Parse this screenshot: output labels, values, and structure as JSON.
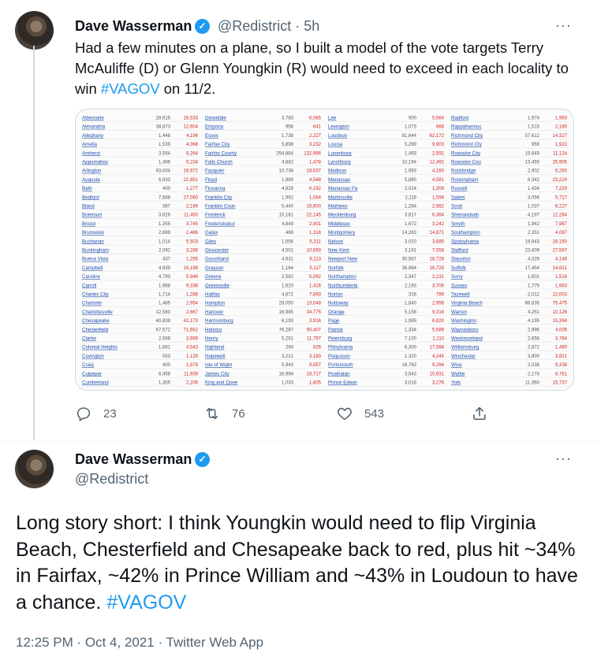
{
  "tweet1": {
    "author_name": "Dave Wasserman",
    "handle": "@Redistrict",
    "time": "5h",
    "text_pre": "Had a few minutes on a plane, so I built a model of the vote targets Terry McAuliffe (D) or Glenn Youngkin (R) would need to exceed in each locality to win ",
    "hashtag": "#VAGOV",
    "text_post": " on 11/2.",
    "replies": "23",
    "retweets": "76",
    "likes": "543",
    "media_table": {
      "columns": [
        [
          [
            "Albemarle",
            "28,615",
            "16,533"
          ],
          [
            "Alexandria",
            "38,873",
            "12,604"
          ],
          [
            "Alleghany",
            "1,448",
            "4,196"
          ],
          [
            "Amelia",
            "1,539",
            "4,068"
          ],
          [
            "Amherst",
            "3,554",
            "8,264"
          ],
          [
            "Appomattox",
            "1,496",
            "5,234"
          ],
          [
            "Arlington",
            "63,004",
            "19,972"
          ],
          [
            "Augusta",
            "6,933",
            "22,851"
          ],
          [
            "Bath",
            "400",
            "1,277"
          ],
          [
            "Bedford",
            "7,688",
            "27,060"
          ],
          [
            "Bland",
            "387",
            "2,169"
          ],
          [
            "Botetourt",
            "3,626",
            "11,450"
          ],
          [
            "Bristol",
            "1,355",
            "3,745"
          ],
          [
            "Brunswick",
            "2,689",
            "2,466"
          ],
          [
            "Buchanan",
            "1,014",
            "5,503"
          ],
          [
            "Buckingham",
            "2,092",
            "3,286"
          ],
          [
            "Buena Vista",
            "437",
            "1,255"
          ],
          [
            "Campbell",
            "4,939",
            "16,199"
          ],
          [
            "Caroline",
            "4,793",
            "5,946"
          ],
          [
            "Carroll",
            "1,968",
            "9,336"
          ],
          [
            "Charles City",
            "1,714",
            "1,286"
          ],
          [
            "Charlotte",
            "1,485",
            "2,954"
          ],
          [
            "Charlottesville",
            "12,583",
            "2,667"
          ],
          [
            "Chesapeake",
            "40,839",
            "42,173"
          ],
          [
            "Chesterfield",
            "67,572",
            "71,662"
          ],
          [
            "Clarke",
            "2,598",
            "3,989"
          ],
          [
            "Colonial Heights",
            "1,661",
            "4,543"
          ],
          [
            "Covington",
            "553",
            "1,129"
          ],
          [
            "Craig",
            "400",
            "1,878"
          ],
          [
            "Culpeper",
            "6,458",
            "11,939"
          ],
          [
            "Cumberland",
            "1,355",
            "2,206"
          ]
        ],
        [
          [
            "Dinwiddie",
            "3,783",
            "6,085"
          ],
          [
            "Emporia",
            "956",
            "641"
          ],
          [
            "Essex",
            "1,738",
            "2,227"
          ],
          [
            "Fairfax City",
            "5,898",
            "3,232"
          ],
          [
            "Fairfax County",
            "254,884",
            "132,996"
          ],
          [
            "Falls Church",
            "4,882",
            "1,478"
          ],
          [
            "Fauquier",
            "10,738",
            "18,637"
          ],
          [
            "Floyd",
            "1,989",
            "4,548"
          ],
          [
            "Fluvanna",
            "4,828",
            "6,192"
          ],
          [
            "Franklin City",
            "1,992",
            "1,084"
          ],
          [
            "Franklin Coun",
            "5,440",
            "15,600"
          ],
          [
            "Frederick",
            "10,181",
            "22,145"
          ],
          [
            "Fredericksbur",
            "4,849",
            "2,901"
          ],
          [
            "Galax",
            "469",
            "1,318"
          ],
          [
            "Giles",
            "1,556",
            "5,311"
          ],
          [
            "Gloucester",
            "4,501",
            "10,693"
          ],
          [
            "Goochland",
            "4,631",
            "8,113"
          ],
          [
            "Grayson",
            "1,164",
            "5,117"
          ],
          [
            "Greene",
            "2,582",
            "5,092"
          ],
          [
            "Greensville",
            "1,620",
            "1,416"
          ],
          [
            "Halifax",
            "4,672",
            "7,893"
          ],
          [
            "Hampton",
            "28,050",
            "13,048"
          ],
          [
            "Hanover",
            "16,985",
            "34,775"
          ],
          [
            "Harrisonburg",
            "6,193",
            "3,916"
          ],
          [
            "Henrico",
            "76,287",
            "50,407"
          ],
          [
            "Henry",
            "5,291",
            "11,797"
          ],
          [
            "Highland",
            "294",
            "826"
          ],
          [
            "Hopewell",
            "3,221",
            "3,183"
          ],
          [
            "Isle of Wight",
            "5,943",
            "9,957"
          ],
          [
            "James City",
            "16,994",
            "18,717"
          ],
          [
            "King and Quee",
            "1,033",
            "1,805"
          ]
        ],
        [
          [
            "Lee",
            "900",
            "5,564"
          ],
          [
            "Lexington",
            "1,073",
            "668"
          ],
          [
            "Loudoun",
            "81,644",
            "62,172"
          ],
          [
            "Louisa",
            "5,299",
            "9,903"
          ],
          [
            "Lunenburg",
            "1,493",
            "2,592"
          ],
          [
            "Lynchburg",
            "10,194",
            "12,492"
          ],
          [
            "Madison",
            "1,993",
            "4,160"
          ],
          [
            "Manassas",
            "5,880",
            "4,581"
          ],
          [
            "Manassas Pa",
            "2,024",
            "1,308"
          ],
          [
            "Martinsville",
            "2,118",
            "1,594"
          ],
          [
            "Mathews",
            "1,284",
            "2,982"
          ],
          [
            "Mecklenburg",
            "3,617",
            "6,364"
          ],
          [
            "Middlesex",
            "1,672",
            "3,242"
          ],
          [
            "Montgomery",
            "14,263",
            "14,871"
          ],
          [
            "Nelson",
            "3,020",
            "3,685"
          ],
          [
            "New Kent",
            "3,191",
            "7,558"
          ],
          [
            "Newport New",
            "30,567",
            "18,728"
          ],
          [
            "Norfolk",
            "36,964",
            "16,728"
          ],
          [
            "Northampton",
            "2,347",
            "2,231"
          ],
          [
            "Northumberla",
            "2,193",
            "3,706"
          ],
          [
            "Norton",
            "316",
            "789"
          ],
          [
            "Nottoway",
            "1,840",
            "2,956"
          ],
          [
            "Orange",
            "5,158",
            "9,316"
          ],
          [
            "Page",
            "1,985",
            "6,820"
          ],
          [
            "Patrick",
            "1,334",
            "5,589"
          ],
          [
            "Petersburg",
            "7,100",
            "1,110"
          ],
          [
            "Pittsylvania",
            "6,300",
            "17,568"
          ],
          [
            "Poquoson",
            "1,320",
            "4,245"
          ],
          [
            "Portsmouth",
            "18,763",
            "9,294"
          ],
          [
            "Powhatan",
            "3,643",
            "10,931"
          ],
          [
            "Prince Edwar",
            "3,018",
            "3,276"
          ]
        ],
        [
          [
            "Radford",
            "1,974",
            "1,963"
          ],
          [
            "Rappahannoc",
            "1,515",
            "2,180"
          ],
          [
            "Richmond City",
            "57,612",
            "14,327"
          ],
          [
            "Richmond Cty",
            "956",
            "1,922"
          ],
          [
            "Roanoke City",
            "15,649",
            "11,124"
          ],
          [
            "Roanoke Cou",
            "13,455",
            "25,905"
          ],
          [
            "Rockbridge",
            "2,902",
            "6,250"
          ],
          [
            "Rockingham",
            "8,342",
            "23,224"
          ],
          [
            "Russell",
            "1,434",
            "7,229"
          ],
          [
            "Salem",
            "3,056",
            "5,717"
          ],
          [
            "Scott",
            "1,037",
            "6,227"
          ],
          [
            "Shenandoah",
            "4,197",
            "12,284"
          ],
          [
            "Smyth",
            "1,942",
            "7,987"
          ],
          [
            "Southampton",
            "2,351",
            "4,087"
          ],
          [
            "Spotsylvania",
            "19,943",
            "28,150"
          ],
          [
            "Stafford",
            "23,609",
            "27,587"
          ],
          [
            "Staunton",
            "4,326",
            "4,146"
          ],
          [
            "Suffolk",
            "17,454",
            "14,621"
          ],
          [
            "Surry",
            "1,601",
            "1,516"
          ],
          [
            "Sussex",
            "1,775",
            "1,663"
          ],
          [
            "Tazewell",
            "2,012",
            "12,003"
          ],
          [
            "Virginia Beach",
            "68,636",
            "75,475"
          ],
          [
            "Warren",
            "4,251",
            "10,126"
          ],
          [
            "Washington",
            "4,195",
            "15,394"
          ],
          [
            "Waynesboro",
            "2,996",
            "4,005"
          ],
          [
            "Westmoreland",
            "2,656",
            "3,784"
          ],
          [
            "Williamsburg",
            "2,872",
            "1,490"
          ],
          [
            "Winchester",
            "3,800",
            "3,821"
          ],
          [
            "Wise",
            "2,038",
            "9,338"
          ],
          [
            "Wythe",
            "2,174",
            "8,761"
          ],
          [
            "York",
            "11,360",
            "15,737"
          ]
        ]
      ]
    }
  },
  "tweet2": {
    "author_name": "Dave Wasserman",
    "handle": "@Redistrict",
    "text_pre": "Long story short: I think Youngkin would need to flip Virginia Beach, Chesterfield and Chesapeake back to red, plus hit ~34% in Fairfax, ~42% in Prince William and ~43% in Loudoun to have a chance. ",
    "hashtag": "#VAGOV",
    "time": "12:25 PM · Oct 4, 2021 · Twitter Web App"
  },
  "colors": {
    "accent": "#1d9bf0",
    "text": "#0f1419",
    "muted": "#536471",
    "table_link": "#1f4fb0",
    "table_red": "#d21f1f"
  },
  "icons": {
    "reply": "speech-bubble-icon",
    "retweet": "retweet-arrows-icon",
    "like": "heart-icon",
    "share": "share-upload-icon",
    "more": "more-dots-icon",
    "verified": "verified-badge-icon"
  }
}
